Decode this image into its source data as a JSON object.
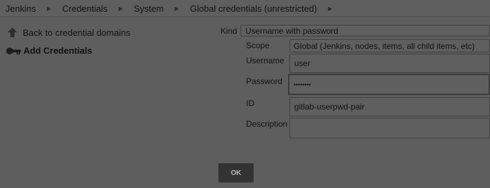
{
  "breadcrumb": {
    "items": [
      "Jenkins",
      "Credentials",
      "System",
      "Global credentials (unrestricted)"
    ]
  },
  "sidebar": {
    "back_label": "Back to credential domains",
    "add_label": "Add Credentials"
  },
  "form": {
    "kind_label": "Kind",
    "kind_value": "Username with password",
    "scope_label": "Scope",
    "scope_value": "Global (Jenkins, nodes, items, all child items, etc)",
    "username_label": "Username",
    "username_value": "user",
    "password_label": "Password",
    "password_value": "••••••••",
    "id_label": "ID",
    "id_value": "gitlab-userpwd-pair",
    "description_label": "Description",
    "description_value": ""
  },
  "ok_label": "OK"
}
